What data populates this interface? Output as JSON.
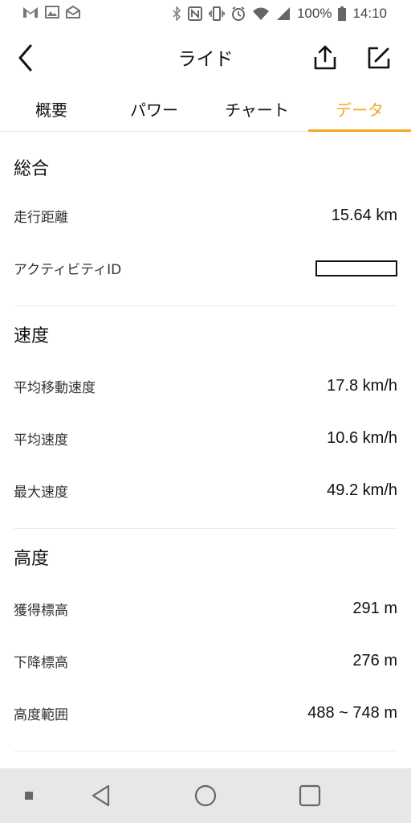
{
  "status_bar": {
    "battery": "100%",
    "time": "14:10"
  },
  "header": {
    "title": "ライド"
  },
  "tabs": [
    {
      "label": "概要",
      "active": false
    },
    {
      "label": "パワー",
      "active": false
    },
    {
      "label": "チャート",
      "active": false
    },
    {
      "label": "データ",
      "active": true
    }
  ],
  "accent_color": "#f5a623",
  "sections": {
    "overall": {
      "title": "総合",
      "rows": [
        {
          "label": "走行距離",
          "value": "15.64 km"
        },
        {
          "label": "アクティビティID",
          "value": ""
        }
      ]
    },
    "speed": {
      "title": "速度",
      "rows": [
        {
          "label": "平均移動速度",
          "value": "17.8 km/h"
        },
        {
          "label": "平均速度",
          "value": "10.6 km/h"
        },
        {
          "label": "最大速度",
          "value": "49.2 km/h"
        }
      ]
    },
    "altitude": {
      "title": "高度",
      "rows": [
        {
          "label": "獲得標高",
          "value": "291 m"
        },
        {
          "label": "下降標高",
          "value": "276 m"
        },
        {
          "label": "高度範囲",
          "value": "488 ~ 748 m"
        }
      ]
    }
  }
}
